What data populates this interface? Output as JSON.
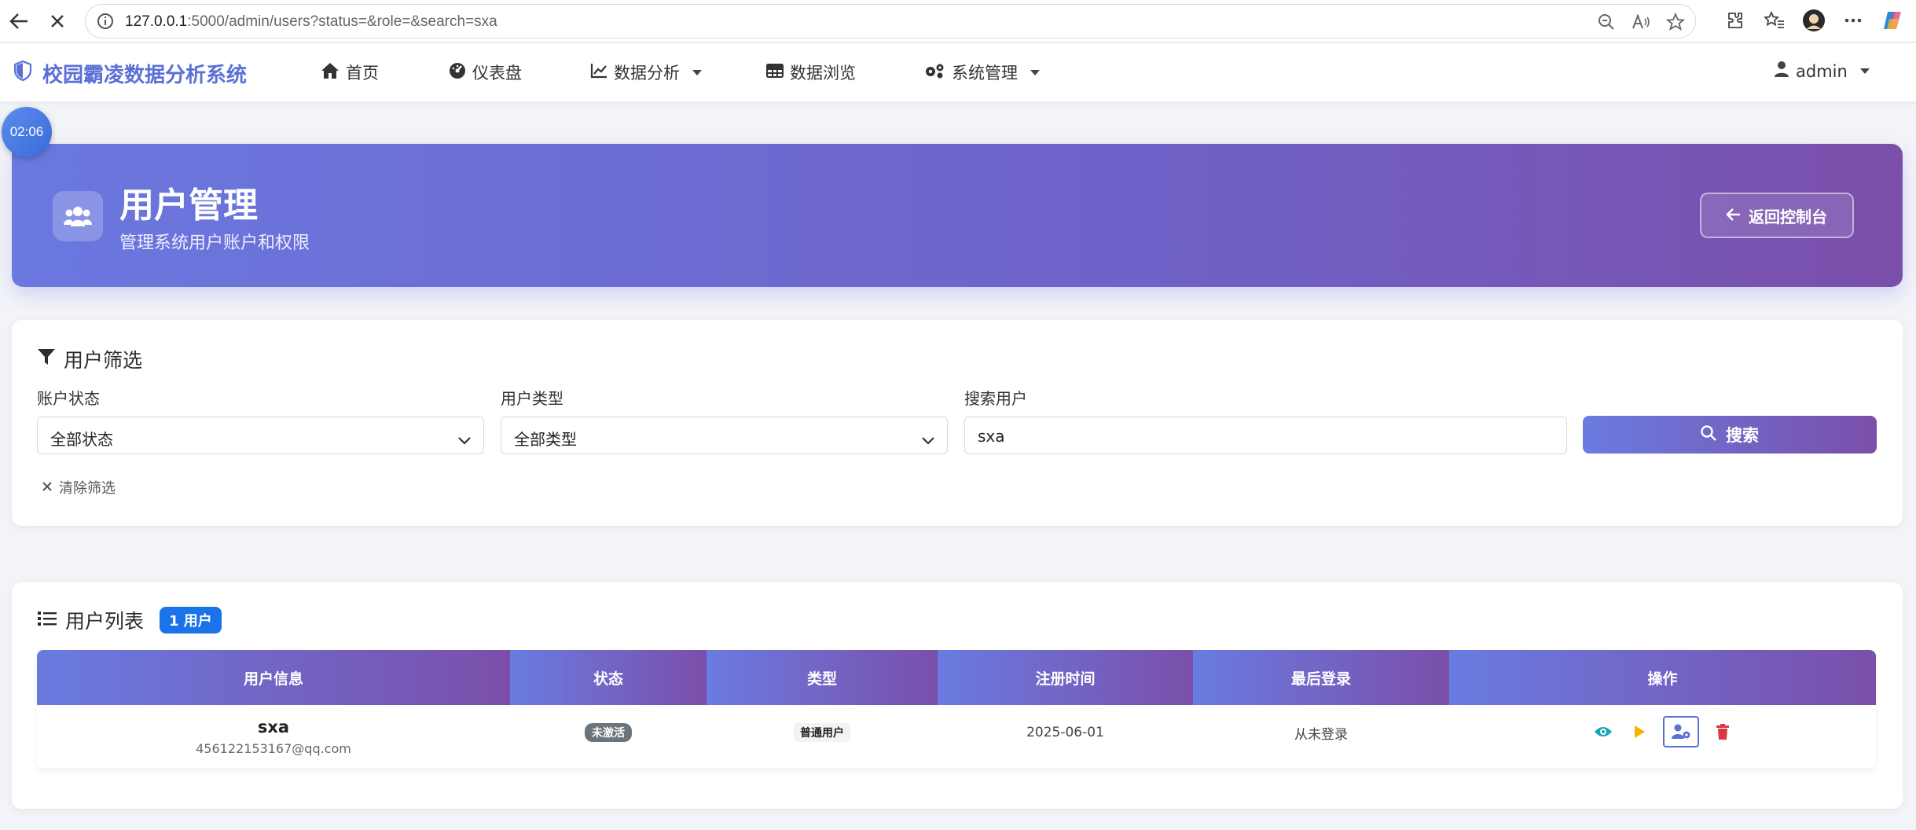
{
  "browser": {
    "url_host": "127.0.0.1",
    "url_rest": ":5000/admin/users?status=&role=&search=sxa"
  },
  "navbar": {
    "brand": "校园霸凌数据分析系统",
    "items": [
      {
        "label": "首页",
        "icon": "home-icon"
      },
      {
        "label": "仪表盘",
        "icon": "dashboard-icon"
      },
      {
        "label": "数据分析",
        "icon": "chart-line-icon",
        "dropdown": true
      },
      {
        "label": "数据浏览",
        "icon": "table-icon"
      },
      {
        "label": "系统管理",
        "icon": "gears-icon",
        "dropdown": true
      }
    ],
    "user": "admin"
  },
  "timer": "02:06",
  "header": {
    "title": "用户管理",
    "subtitle": "管理系统用户账户和权限",
    "back_label": "返回控制台"
  },
  "filter": {
    "title": "用户筛选",
    "status_label": "账户状态",
    "status_value": "全部状态",
    "role_label": "用户类型",
    "role_value": "全部类型",
    "search_label": "搜索用户",
    "search_value": "sxa",
    "search_button": "搜索",
    "clear_label": "清除筛选"
  },
  "list": {
    "title": "用户列表",
    "count_badge": "1 用户",
    "columns": [
      "用户信息",
      "状态",
      "类型",
      "注册时间",
      "最后登录",
      "操作"
    ],
    "rows": [
      {
        "username": "sxa",
        "email": "456122153167@qq.com",
        "status": "未激活",
        "type": "普通用户",
        "registered": "2025-06-01",
        "last_login": "从未登录"
      }
    ]
  },
  "colors": {
    "primary": "#6a7be0",
    "secondary": "#7a4faa",
    "view_icon": "#17a2b8",
    "activate_icon": "#f0b400",
    "role_icon": "#5b6fd6",
    "delete_icon": "#dc3545"
  }
}
